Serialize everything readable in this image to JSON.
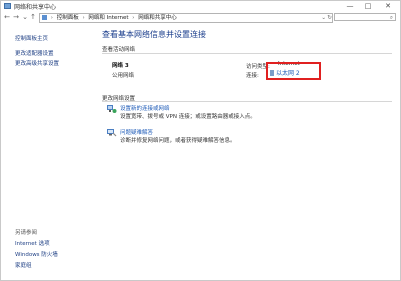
{
  "window": {
    "title": "网络和共享中心",
    "buttons": [
      "—",
      "□",
      "✕"
    ]
  },
  "address_bar": {
    "breadcrumbs": [
      "控制面板",
      "网络和 Internet",
      "网络和共享中心"
    ],
    "search_placeholder": ""
  },
  "sidebar": {
    "items": [
      {
        "label": "控制面板主页"
      },
      {
        "label": "更改适配器设置"
      },
      {
        "label": "更改高级共享设置"
      }
    ],
    "see_also_title": "另请参阅",
    "see_also": [
      {
        "label": "Internet 选项"
      },
      {
        "label": "Windows 防火墙"
      },
      {
        "label": "家庭组"
      }
    ]
  },
  "main": {
    "heading": "查看基本网络信息并设置连接",
    "active_networks_label": "查看活动网络",
    "network": {
      "name": "网络 3",
      "type": "公用网络",
      "access_type_label": "访问类型:",
      "access_type_value": "Internet",
      "connection_label": "连接:",
      "connection_value": "以太网 2"
    },
    "change_settings_label": "更改网络设置",
    "tasks": [
      {
        "title": "设置新的连接或网络",
        "description": "设置宽带、拨号或 VPN 连接；或设置路由器或接入点。"
      },
      {
        "title": "问题疑难解答",
        "description": "诊断并修复网络问题，或者获得疑难解答信息。"
      }
    ]
  },
  "colors": {
    "link": "#1e5bb8",
    "heading": "#1a3d8c",
    "highlight": "#e02020"
  }
}
